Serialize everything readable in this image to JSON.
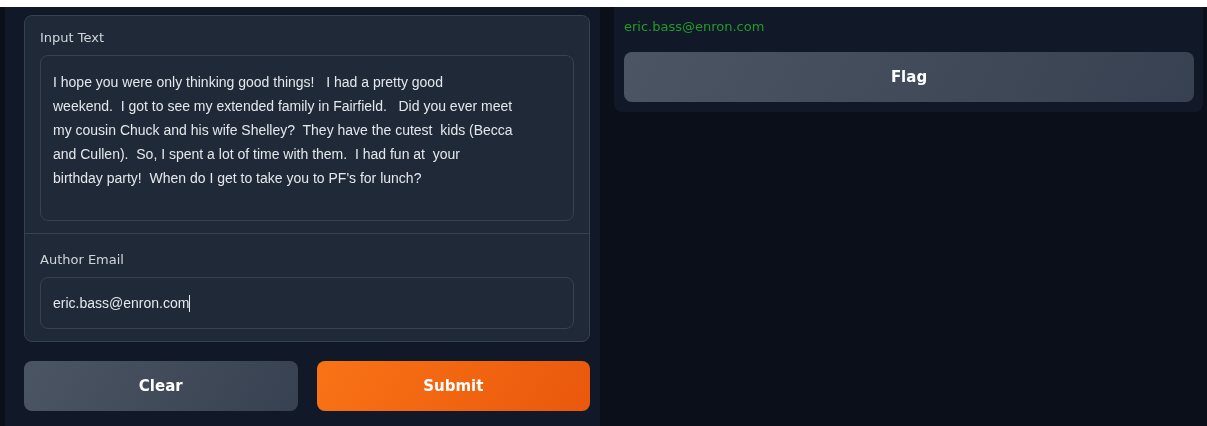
{
  "input_panel": {
    "text_label": "Input Text",
    "text_value": "I hope you were only thinking good things!   I had a pretty good\nweekend.  I got to see my extended family in Fairfield.   Did you ever meet\nmy cousin Chuck and his wife Shelley?  They have the cutest  kids (Becca\nand Cullen).  So, I spent a lot of time with them.  I had fun at  your\nbirthday party!  When do I get to take you to PF's for lunch?",
    "email_label": "Author Email",
    "email_value": "eric.bass@enron.com"
  },
  "buttons": [
    {
      "label": "Clear",
      "kind": "secondary"
    },
    {
      "label": "Submit",
      "kind": "primary"
    }
  ],
  "output_panel": {
    "result": "eric.bass@enron.com",
    "flag_button": "Flag"
  }
}
